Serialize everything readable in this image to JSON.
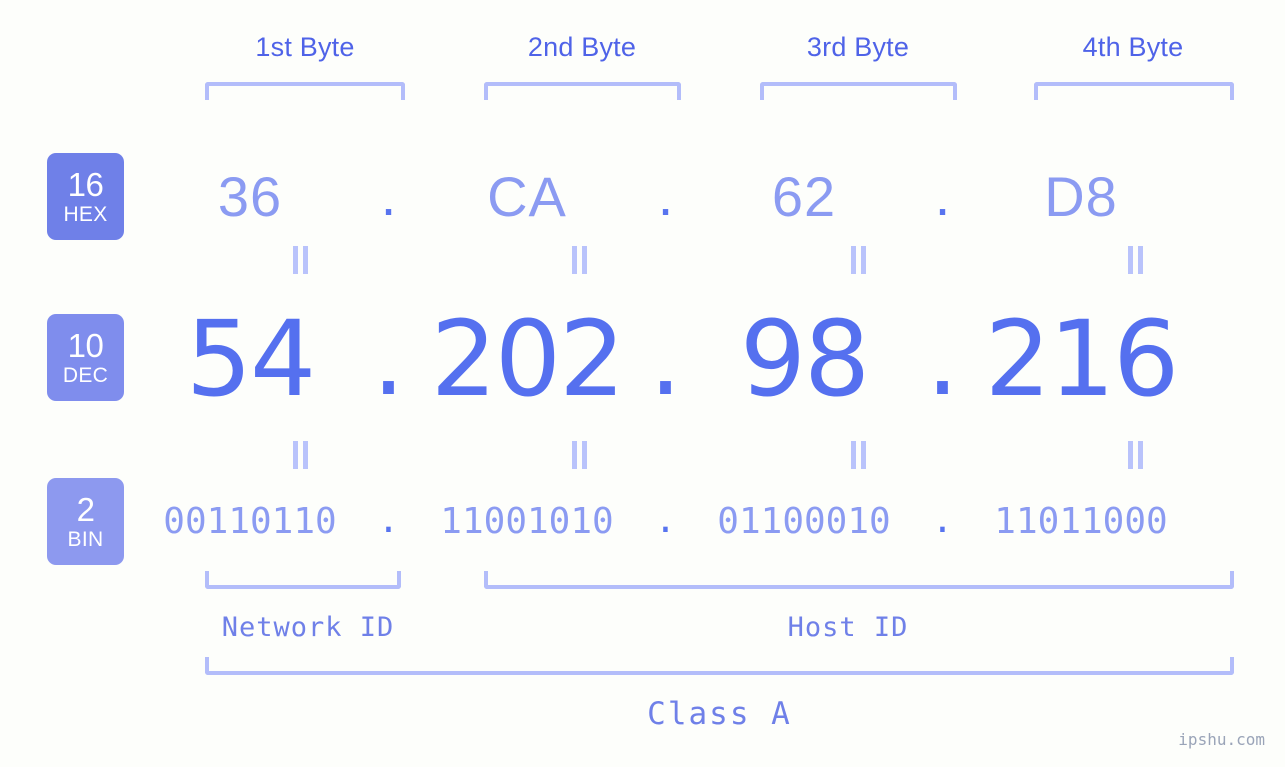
{
  "watermark": "ipshu.com",
  "byte_headers": [
    {
      "label": "1st Byte"
    },
    {
      "label": "2nd Byte"
    },
    {
      "label": "3rd Byte"
    },
    {
      "label": "4th Byte"
    }
  ],
  "rows": {
    "hex": {
      "badge_number": "16",
      "badge_text": "HEX",
      "base": 16,
      "separator": ".",
      "values": [
        "36",
        "CA",
        "62",
        "D8"
      ]
    },
    "dec": {
      "badge_number": "10",
      "badge_text": "DEC",
      "base": 10,
      "separator": ".",
      "values": [
        "54",
        "202",
        "98",
        "216"
      ]
    },
    "bin": {
      "badge_number": "2",
      "badge_text": "BIN",
      "base": 2,
      "separator": ".",
      "values": [
        "00110110",
        "11001010",
        "01100010",
        "11011000"
      ]
    }
  },
  "ip_address": "54.202.98.216",
  "segments": {
    "network_id": "Network ID",
    "host_id": "Host ID",
    "class": "Class A"
  },
  "colors": {
    "background": "#fdfefb",
    "badge_hex": "#6f80e8",
    "badge_dec": "#7f8ded",
    "badge_bin": "#8d99ef",
    "bracket": "#b3bdfa",
    "value_light": "#8b9bf2",
    "value_strong": "#5570ef",
    "header_text": "#4f63e8",
    "watermark_text": "#9aa4b8"
  }
}
